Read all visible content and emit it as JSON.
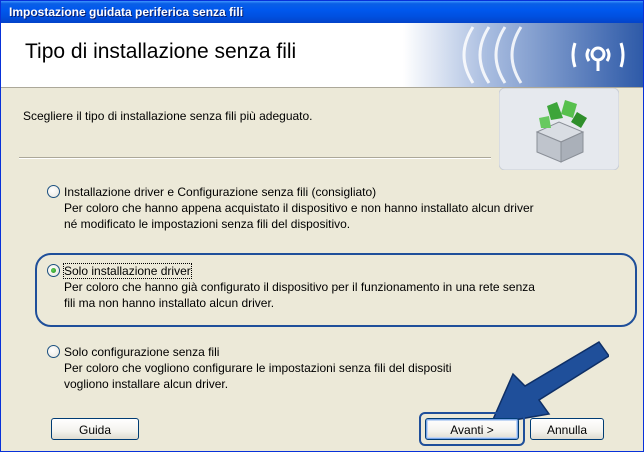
{
  "window": {
    "title": "Impostazione guidata periferica senza fili"
  },
  "header": {
    "title": "Tipo di installazione senza fili",
    "icon": "wifi-signal-icon"
  },
  "main": {
    "intro": "Scegliere il tipo di installazione senza fili più adeguato.",
    "options": [
      {
        "label": "Installazione driver e Configurazione senza fili (consigliato)",
        "desc_line1": "Per coloro che hanno appena acquistato il dispositivo e non hanno installato alcun driver",
        "desc_line2": "né modificato le impostazioni senza fili del dispositivo.",
        "selected": false
      },
      {
        "label": "Solo installazione driver",
        "desc_line1": "Per coloro che hanno già configurato il dispositivo per il funzionamento in una rete senza",
        "desc_line2": "fili ma non hanno installato alcun driver.",
        "selected": true
      },
      {
        "label": "Solo configurazione senza fili",
        "desc_line1": "Per coloro che vogliono configurare le impostazioni senza fili del dispositi",
        "desc_line2": "vogliono installare alcun driver.",
        "selected": false
      }
    ]
  },
  "buttons": {
    "help": "Guida",
    "next": "Avanti >",
    "cancel": "Annulla"
  },
  "colors": {
    "accent": "#1f4f9a",
    "titlebar": "#0058ee",
    "dialog_bg": "#ece9d8"
  }
}
